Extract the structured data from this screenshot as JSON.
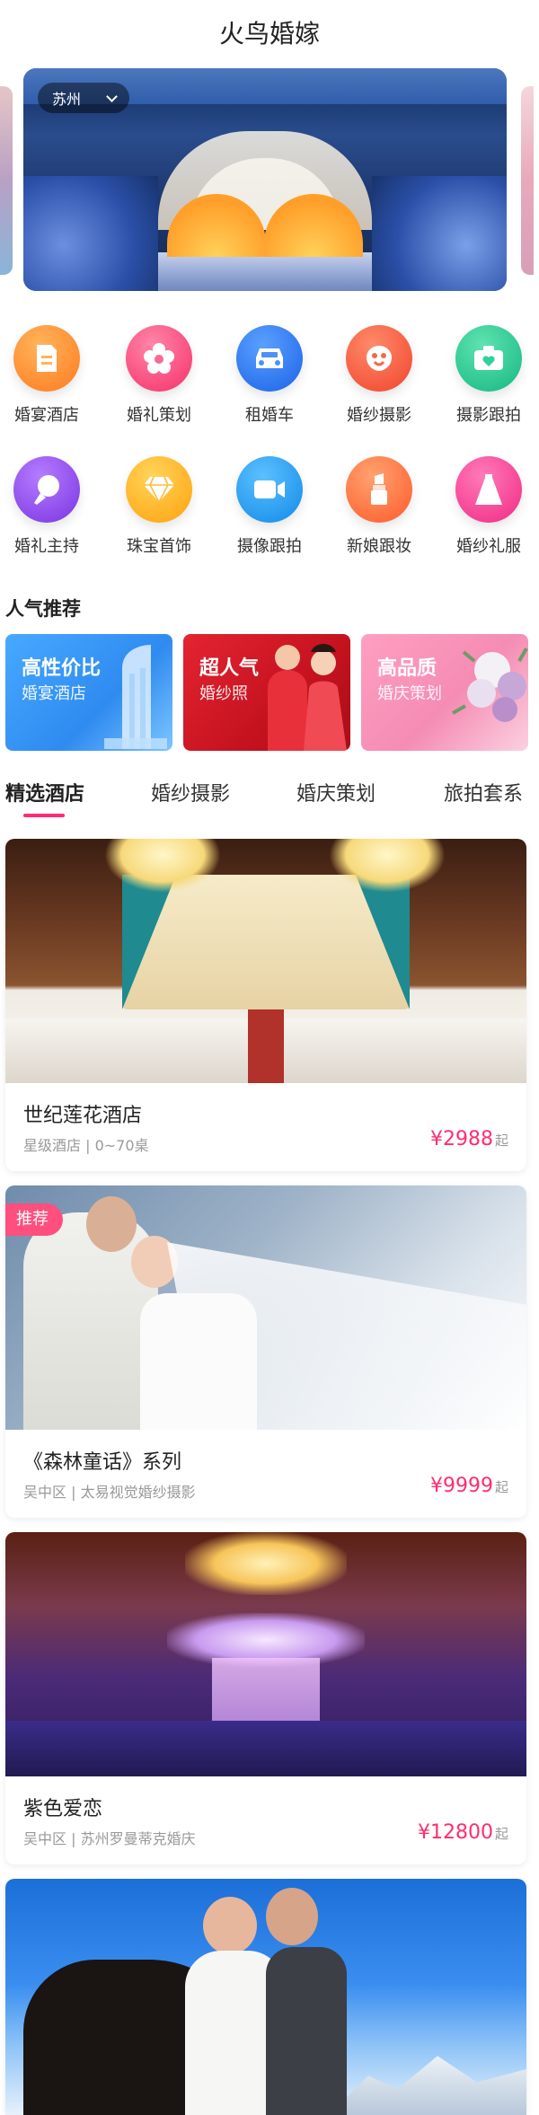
{
  "header": {
    "title": "火鸟婚嫁"
  },
  "banner": {
    "city": "苏州"
  },
  "categories": [
    {
      "label": "婚宴酒店",
      "icon": "document-icon",
      "color": "#ff8a2b"
    },
    {
      "label": "婚礼策划",
      "icon": "flower-icon",
      "color": "#ff4f7e"
    },
    {
      "label": "租婚车",
      "icon": "car-icon",
      "color": "#2f7cf6"
    },
    {
      "label": "婚纱摄影",
      "icon": "couple-icon",
      "color": "#ff5a3c"
    },
    {
      "label": "摄影跟拍",
      "icon": "camera-icon",
      "color": "#22c58f"
    },
    {
      "label": "婚礼主持",
      "icon": "microphone-icon",
      "color": "#8f4be8"
    },
    {
      "label": "珠宝首饰",
      "icon": "diamond-icon",
      "color": "#ffb21c"
    },
    {
      "label": "摄像跟拍",
      "icon": "video-camera-icon",
      "color": "#1e9bf0"
    },
    {
      "label": "新娘跟妆",
      "icon": "lipstick-icon",
      "color": "#ff6f3c"
    },
    {
      "label": "婚纱礼服",
      "icon": "dress-icon",
      "color": "#ff3f8a"
    }
  ],
  "popular": {
    "title": "人气推荐",
    "cards": [
      {
        "title": "高性价比",
        "subtitle": "婚宴酒店",
        "color": "#3d9cf5"
      },
      {
        "title": "超人气",
        "subtitle": "婚纱照",
        "color": "#d8232f"
      },
      {
        "title": "高品质",
        "subtitle": "婚庆策划",
        "color": "#f38fb4"
      }
    ]
  },
  "tabs": [
    "精选酒店",
    "婚纱摄影",
    "婚庆策划",
    "旅拍套系"
  ],
  "active_tab": "精选酒店",
  "listings": [
    {
      "name": "世纪莲花酒店",
      "meta": "星级酒店 | 0~70桌",
      "price": "¥2988",
      "unit": "起",
      "badge": ""
    },
    {
      "name": "《森林童话》系列",
      "meta": "吴中区 | 太易视觉婚纱摄影",
      "price": "¥9999",
      "unit": "起",
      "badge": "推荐"
    },
    {
      "name": "紫色爱恋",
      "meta": "吴中区 | 苏州罗曼蒂克婚庆",
      "price": "¥12800",
      "unit": "起",
      "badge": ""
    },
    {
      "name": "",
      "meta": "",
      "price": "",
      "unit": "",
      "badge": ""
    }
  ],
  "colors": {
    "accent": "#ff2d6f",
    "badge": "#ff4f7e"
  }
}
